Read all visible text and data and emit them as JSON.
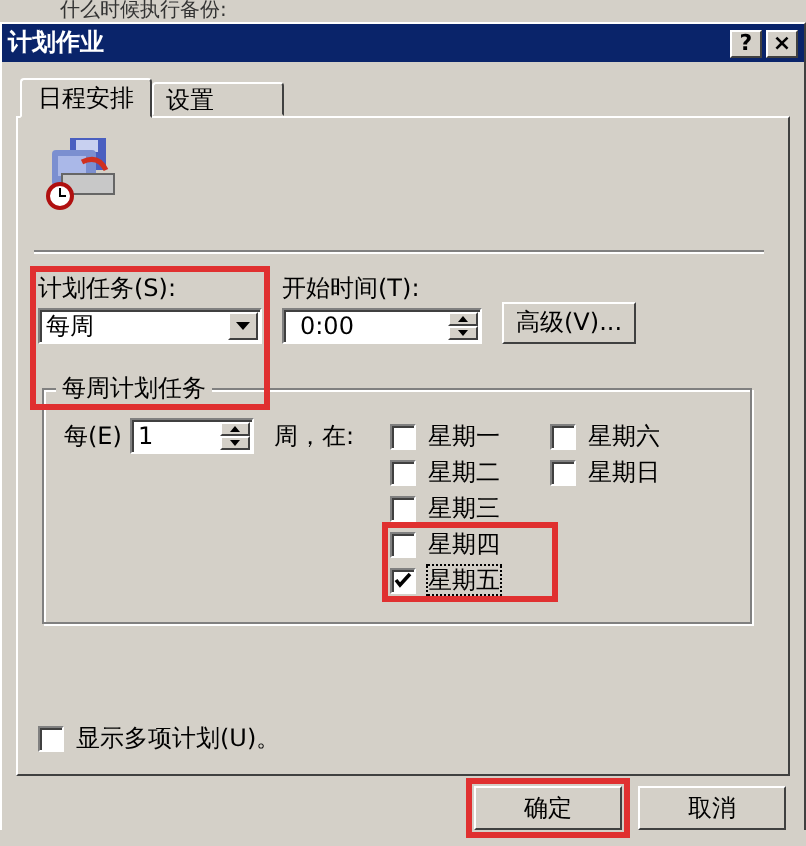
{
  "background_text": "什么时候执行备份:",
  "window": {
    "title": "计划作业",
    "help_button": "?",
    "close_button": "×"
  },
  "tabs": [
    {
      "label": "日程安排",
      "selected": true
    },
    {
      "label": "设置",
      "selected": false
    }
  ],
  "schedule_type": {
    "label": "计划任务(S):",
    "value": "每周",
    "highlighted": true
  },
  "start_time": {
    "label": "开始时间(T):",
    "value": "0:00"
  },
  "advanced_button": "高级(V)...",
  "weekly_group": {
    "title": "每周计划任务",
    "every_label": "每(E)",
    "every_value": "1",
    "unit_label": "周，在:"
  },
  "days": [
    {
      "label": "星期一",
      "checked": false,
      "highlighted": false
    },
    {
      "label": "星期二",
      "checked": false,
      "highlighted": false
    },
    {
      "label": "星期三",
      "checked": false,
      "highlighted": false
    },
    {
      "label": "星期四",
      "checked": false,
      "highlighted": true
    },
    {
      "label": "星期五",
      "checked": true,
      "highlighted": true
    },
    {
      "label": "星期六",
      "checked": false,
      "highlighted": false
    },
    {
      "label": "星期日",
      "checked": false,
      "highlighted": false
    }
  ],
  "show_multiple": {
    "label": "显示多项计划(U)。",
    "checked": false
  },
  "buttons": [
    {
      "label": "确定",
      "highlighted": true
    },
    {
      "label": "取消",
      "highlighted": false
    }
  ]
}
